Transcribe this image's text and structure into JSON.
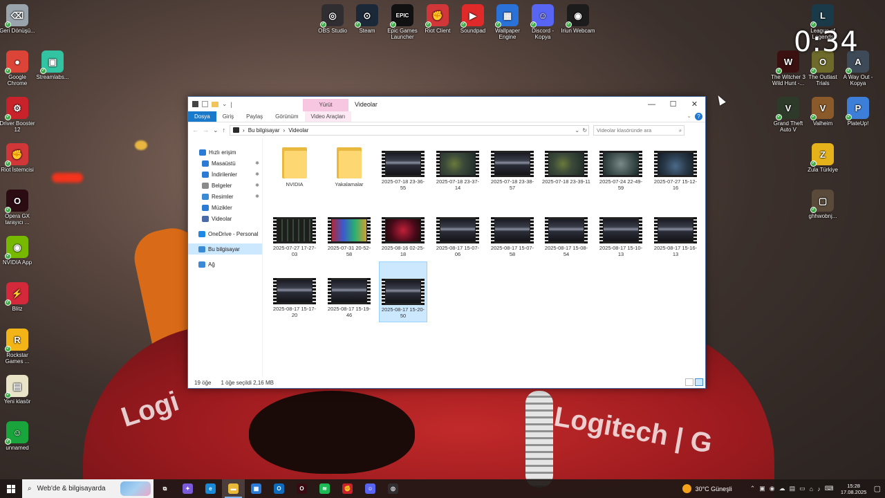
{
  "desktop": {
    "timer": "0:34",
    "left_icons": [
      {
        "label": "Geri Dönüşü...",
        "glyph": "⌫",
        "color": "#9aa4ad",
        "icon": "recycle-bin-icon"
      },
      {
        "label": "Google Chrome",
        "glyph": "●",
        "color": "#db4437",
        "icon": "chrome-icon"
      },
      {
        "label": "Driver Booster 12",
        "glyph": "⚙",
        "color": "#c8232b",
        "icon": "driver-booster-icon"
      },
      {
        "label": "Riot İstemcisi",
        "glyph": "✊",
        "color": "#d13639",
        "icon": "riot-client-icon"
      },
      {
        "label": "Opera GX tarayıcı ...",
        "glyph": "O",
        "color": "#2a0c12",
        "icon": "opera-gx-icon"
      },
      {
        "label": "NVIDIA App",
        "glyph": "◉",
        "color": "#76b900",
        "icon": "nvidia-icon"
      },
      {
        "label": "Blitz",
        "glyph": "⚡",
        "color": "#d4283b",
        "icon": "blitz-icon"
      },
      {
        "label": "Rockstar Games ...",
        "glyph": "R",
        "color": "#f3b417",
        "icon": "rockstar-icon"
      },
      {
        "label": "Yeni klasör",
        "glyph": "▤",
        "color": "#e9e3c8",
        "icon": "new-folder-icon"
      },
      {
        "label": "unnamed",
        "glyph": "☺",
        "color": "#19a53b",
        "icon": "minecraft-icon"
      }
    ],
    "second_col_icons": [
      {
        "label": "Streamlabs...",
        "glyph": "▣",
        "color": "#31c3a2",
        "icon": "streamlabs-icon"
      }
    ],
    "top_icons": [
      {
        "label": "OBS Studio",
        "glyph": "◎",
        "color": "#302e31",
        "icon": "obs-icon"
      },
      {
        "label": "Steam",
        "glyph": "⊙",
        "color": "#1b2838",
        "icon": "steam-icon"
      },
      {
        "label": "Epic Games Launcher",
        "glyph": "EPIC",
        "color": "#111111",
        "icon": "epic-games-icon"
      },
      {
        "label": "Riot Client",
        "glyph": "✊",
        "color": "#d13639",
        "icon": "riot-client-icon"
      },
      {
        "label": "Soundpad",
        "glyph": "▶",
        "color": "#e02a2a",
        "icon": "soundpad-icon"
      },
      {
        "label": "Wallpaper Engine",
        "glyph": "▦",
        "color": "#2a72d8",
        "icon": "wallpaper-engine-icon"
      },
      {
        "label": "Discord - Kopya",
        "glyph": "☺",
        "color": "#5865f2",
        "icon": "discord-icon"
      },
      {
        "label": "Iriun Webcam",
        "glyph": "◉",
        "color": "#1c1c1c",
        "icon": "iriun-webcam-icon"
      }
    ],
    "right_icons": [
      {
        "label": "League of Legends",
        "glyph": "L",
        "color": "#1a3a4a",
        "icon": "league-icon"
      },
      {
        "label": "The Witcher 3 Wild Hunt -...",
        "glyph": "W",
        "color": "#3a1010",
        "icon": "witcher-icon"
      },
      {
        "label": "The Outlast Trials",
        "glyph": "O",
        "color": "#6e6a2a",
        "icon": "outlast-icon"
      },
      {
        "label": "A Way Out - Kopya",
        "glyph": "A",
        "color": "#3e4a58",
        "icon": "a-way-out-icon"
      },
      {
        "label": "Grand Theft Auto V",
        "glyph": "V",
        "color": "#2d3a2a",
        "icon": "gta-icon"
      },
      {
        "label": "Valheim",
        "glyph": "V",
        "color": "#8a5a2a",
        "icon": "valheim-icon"
      },
      {
        "label": "PlateUp!",
        "glyph": "P",
        "color": "#3d7fd8",
        "icon": "plateup-icon"
      },
      {
        "label": "Zula Türkiye",
        "glyph": "Z",
        "color": "#e6b21c",
        "icon": "zula-icon"
      },
      {
        "label": "ghhwobnj...",
        "glyph": "▢",
        "color": "#5a4a3a",
        "icon": "image-file-icon"
      }
    ]
  },
  "explorer": {
    "ctx_tab": "Yürüt",
    "title": "Videolar",
    "ribbon_tabs": [
      "Dosya",
      "Giriş",
      "Paylaş",
      "Görünüm",
      "Video Araçları"
    ],
    "breadcrumb": [
      "Bu bilgisayar",
      "Videolar"
    ],
    "search_placeholder": "Videolar klasöründe ara",
    "nav_items": [
      {
        "label": "Hızlı erişim",
        "color": "#2b7bd6",
        "pinned": false
      },
      {
        "label": "Masaüstü",
        "color": "#2b7bd6",
        "pinned": true
      },
      {
        "label": "İndirilenler",
        "color": "#2b7bd6",
        "pinned": true
      },
      {
        "label": "Belgeler",
        "color": "#8a8a8a",
        "pinned": true
      },
      {
        "label": "Resimler",
        "color": "#3a8ad6",
        "pinned": true
      },
      {
        "label": "Müzikler",
        "color": "#2b7bd6",
        "pinned": false
      },
      {
        "label": "Videolar",
        "color": "#4a6aa8",
        "pinned": false
      },
      {
        "label": "OneDrive - Personal",
        "color": "#1e88e5",
        "pinned": false
      },
      {
        "label": "Bu bilgisayar",
        "color": "#3a8ad6",
        "pinned": false
      },
      {
        "label": "Ağ",
        "color": "#3a8ad6",
        "pinned": false
      }
    ],
    "folders": [
      "NVIDIA",
      "Yakalamalar"
    ],
    "videos": [
      {
        "name": "2025-07-18 23-36-55",
        "shot": "menu"
      },
      {
        "name": "2025-07-18 23-37-14",
        "shot": "game"
      },
      {
        "name": "2025-07-18 23-38-57",
        "shot": "menu"
      },
      {
        "name": "2025-07-18 23-39-11",
        "shot": "game"
      },
      {
        "name": "2025-07-24 22-49-59",
        "shot": "game2"
      },
      {
        "name": "2025-07-27 15-12-16",
        "shot": "game3"
      },
      {
        "name": "2025-07-27 17-27-03",
        "shot": "dark"
      },
      {
        "name": "2025-07-31 20-52-58",
        "shot": "colorful"
      },
      {
        "name": "2025-08-16 02-25-18",
        "shot": "red"
      },
      {
        "name": "2025-08-17 15-07-06",
        "shot": "menu"
      },
      {
        "name": "2025-08-17 15-07-58",
        "shot": "menu"
      },
      {
        "name": "2025-08-17 15-08-54",
        "shot": "menu"
      },
      {
        "name": "2025-08-17 15-10-13",
        "shot": "menu"
      },
      {
        "name": "2025-08-17 15-16-13",
        "shot": "menu"
      },
      {
        "name": "2025-08-17 15-17-20",
        "shot": "menu"
      },
      {
        "name": "2025-08-17 15-19-46",
        "shot": "menu"
      },
      {
        "name": "2025-08-17 15-20-50",
        "shot": "menu"
      }
    ],
    "selected_index": 16,
    "status_count": "19 öğe",
    "status_selection": "1 öğe seçildi  2,16 MB"
  },
  "taskbar": {
    "search_placeholder": "Web'de & bilgisayarda",
    "weather": "30°C  Güneşli",
    "time": "15:28",
    "date": "17.08.2025",
    "apps": [
      {
        "icon": "task-view-icon",
        "glyph": "⧉",
        "color": "transparent"
      },
      {
        "icon": "copilot-icon",
        "glyph": "✦",
        "color": "#7a5ad8"
      },
      {
        "icon": "edge-icon",
        "glyph": "e",
        "color": "#1a8ad8"
      },
      {
        "icon": "file-explorer-icon",
        "glyph": "▬",
        "color": "#e9b93a",
        "active": true
      },
      {
        "icon": "store-icon",
        "glyph": "▦",
        "color": "#2a7ad6"
      },
      {
        "icon": "outlook-icon",
        "glyph": "O",
        "color": "#0f6cbd"
      },
      {
        "icon": "opera-gx-taskbar-icon",
        "glyph": "O",
        "color": "#3a0a12"
      },
      {
        "icon": "spotify-icon",
        "glyph": "≋",
        "color": "#1db954"
      },
      {
        "icon": "riot-taskbar-icon",
        "glyph": "✊",
        "color": "#c8232b"
      },
      {
        "icon": "discord-taskbar-icon",
        "glyph": "☺",
        "color": "#5865f2"
      },
      {
        "icon": "obs-taskbar-icon",
        "glyph": "◎",
        "color": "#302e31"
      }
    ]
  }
}
